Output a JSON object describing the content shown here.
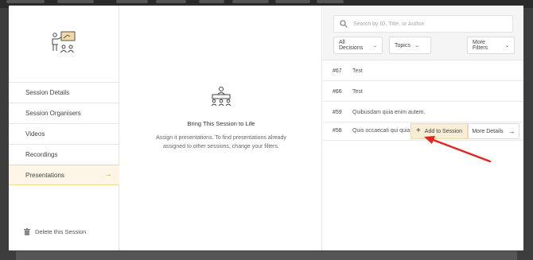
{
  "close_label": "×",
  "nav": {
    "items": [
      {
        "label": "Session Details"
      },
      {
        "label": "Session Organisers"
      },
      {
        "label": "Videos"
      },
      {
        "label": "Recordings"
      },
      {
        "label": "Presentations",
        "arrow": "→"
      }
    ],
    "delete_label": "Delete this Session"
  },
  "middle": {
    "title": "Bring This Session to Life",
    "text": "Assign it presentations. To find presentations already assigned to other sessions, change your filters."
  },
  "search": {
    "placeholder": "Search by ID, Title, or Author",
    "value": ""
  },
  "filters": {
    "decisions": "All Decisions",
    "topics": "Topics",
    "more": "More Filters"
  },
  "rows": [
    {
      "id": "#67",
      "title": "Test"
    },
    {
      "id": "#66",
      "title": "Test"
    },
    {
      "id": "#59",
      "title": "Quibusdam quia enim autem."
    },
    {
      "id": "#58",
      "title": "Quis occaecati qui quia"
    }
  ],
  "actions": {
    "add": "Add to Session",
    "add_icon": "+",
    "more": "More Details",
    "more_icon": "→"
  },
  "colors": {
    "accent": "#e0a12a",
    "annotation_arrow": "#e0261e"
  }
}
